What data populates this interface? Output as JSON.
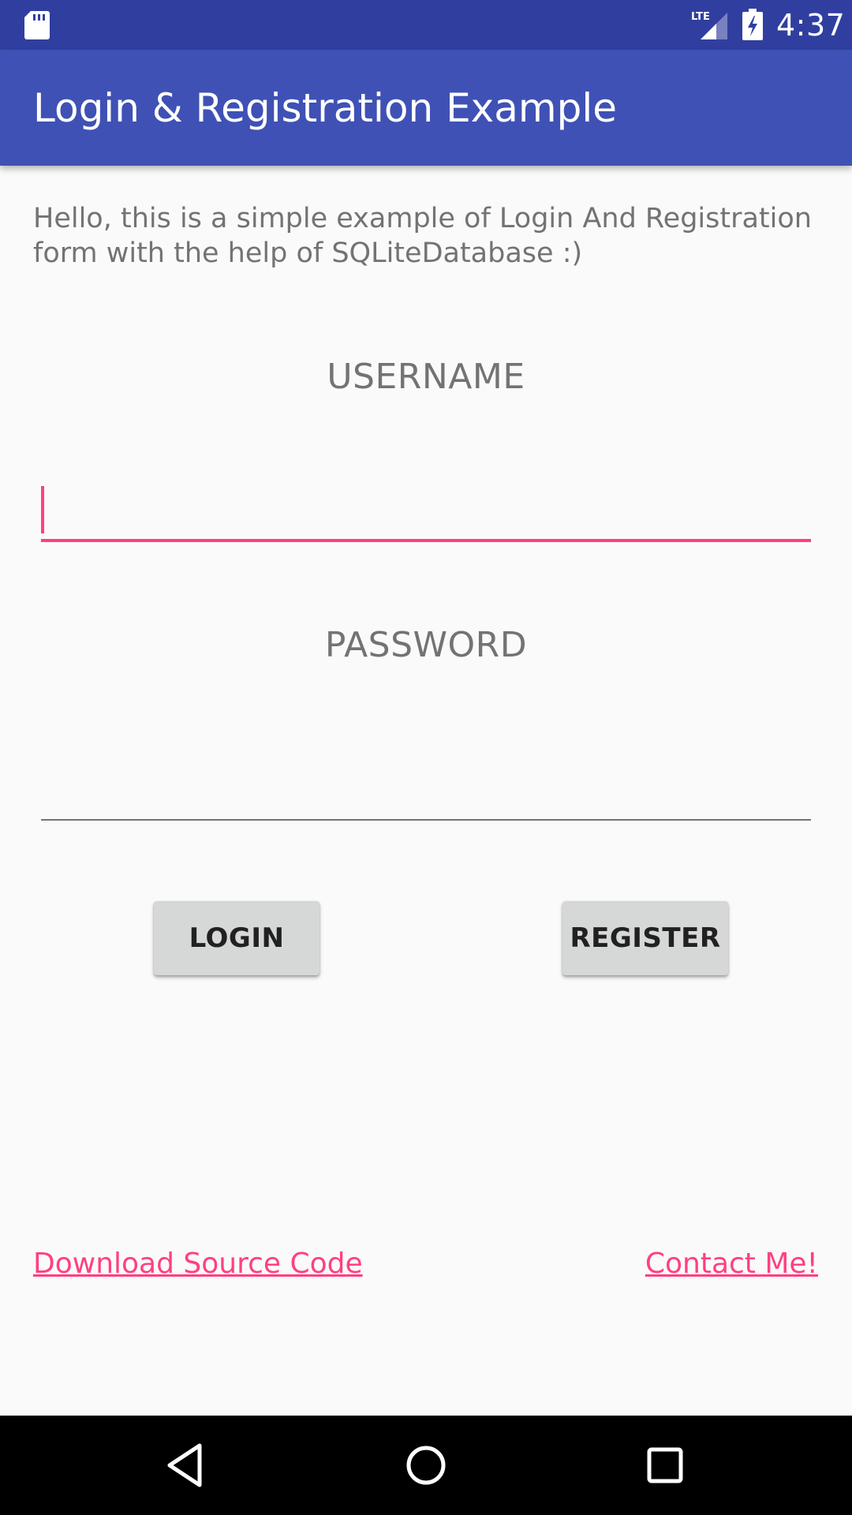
{
  "status_bar": {
    "network": "LTE",
    "time": "4:37",
    "icons": [
      "sd-card-icon",
      "signal-icon",
      "battery-charging-icon"
    ]
  },
  "app_bar": {
    "title": "Login & Registration Example"
  },
  "intro": {
    "text": "Hello, this is a simple example of Login And Registration form with the help of SQLiteDatabase :)"
  },
  "form": {
    "username_label": "USERNAME",
    "username_value": "",
    "password_label": "PASSWORD",
    "password_value": "",
    "login_label": "LOGIN",
    "register_label": "REGISTER"
  },
  "links": {
    "download": "Download Source Code",
    "contact": "Contact Me!"
  },
  "nav_bar": {
    "icons": [
      "back-icon",
      "home-icon",
      "recents-icon"
    ]
  },
  "colors": {
    "status_bar": "#303f9f",
    "app_bar": "#3f51b5",
    "accent": "#ff4081",
    "background": "#fafafa",
    "button": "#d6d7d7"
  }
}
